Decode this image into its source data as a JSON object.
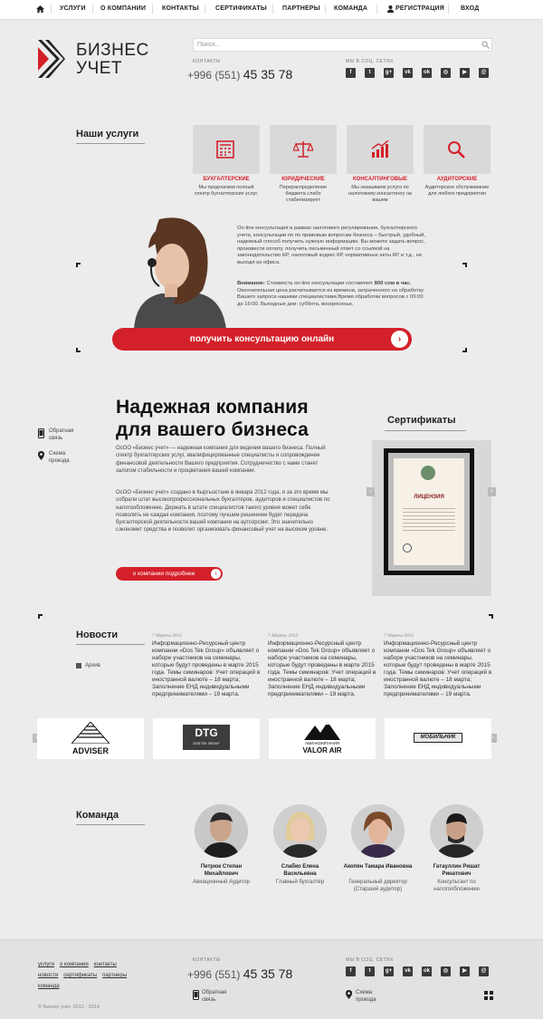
{
  "nav": {
    "items": [
      "УСЛУГИ",
      "О КОМПАНИИ",
      "КОНТАКТЫ",
      "СЕРТИФИКАТЫ",
      "ПАРТНЕРЫ",
      "КОМАНДА",
      "РЕГИСТРАЦИЯ",
      "ВХОД"
    ]
  },
  "logo": {
    "line1": "БИЗНЕС",
    "line2": "УЧЕТ"
  },
  "search": {
    "placeholder": "Поиск..."
  },
  "contacts": {
    "label": "КОНТАКТЫ",
    "phone_prefix": "+996 (551)",
    "phone_main": "45 35 78"
  },
  "social": {
    "label": "МЫ В СОЦ. СЕТЯХ",
    "icons": [
      "facebook-icon",
      "twitter-icon",
      "google-plus-icon",
      "vk-icon",
      "odnoklassniki-icon",
      "instagram-icon",
      "youtube-icon",
      "moimir-icon"
    ]
  },
  "services": {
    "title": "Наши услуги",
    "items": [
      {
        "name": "БУХГАЛТЕРСКИЕ",
        "desc": "Мы предлагаем полный спектр бухгалтерских услуг."
      },
      {
        "name": "ЮРИДИЧЕСКИЕ",
        "desc": "Перераспределение бюджета слабо стабилизирует"
      },
      {
        "name": "КОНСАЛТИНГОВЫЕ",
        "desc": "Мы оказываем услуги по налоговому консалтингу на вашем"
      },
      {
        "name": "АУДИТОРСКИЕ",
        "desc": "Аудиторское обслуживание для любого предприятия"
      }
    ]
  },
  "consult": {
    "text": "On-line консультация в рамках налогового регулирования, бухгалтерского учета, консультации по по правовым вопросам бизнеса – быстрый, удобный, надежный способ получить нужную информацию. Вы можете задать вопрос, произвести оплату, получить письменный ответ со ссылкой на законодательство КР; налоговый кодекс КР, нормативные акты КР, и т.д., не выходя из офиса.",
    "note_bold": "Внимание:",
    "note_text1": "Стоимость on-line консультации составляет",
    "note_price": "800 сом в час.",
    "note_text2": "Окончательная цена расчитывается из времени, затраченного на обработку Вашего запроса нашими специалистами.Время обработки вопросов с 09:00 до 16:00. Выходные дни: суббота, воскресенье.",
    "button": "получить консультацию онлайн"
  },
  "company": {
    "title_line1": "Надежная компания",
    "title_line2": "для вашего бизнеса",
    "para1": "ОсОО «Бизнес учет» — надежная компания для ведения вашего бизнеса. Полный спектр бухгалтерских услуг, квалифицированные специалисты и сопровождение финансовой деятельности Вашего предприятия. Сотрудничество с нами станет залогом стабильности и процветания вашей компании.",
    "para2": "ОсОО «Бизнес учет» создано в Кыргызстане в январе 2012 года, и за это время мы собрали штат высокопрофессиональных бухгалтеров, аудиторов и специалистов по налогообложению. Держать в штате специалистов такого уровня может себе позволить не каждая компания, поэтому лучшим решением будет передача бухгалтерской деятельности вашей компании на аутсорсинг. Это значительно сэкономит средства и позволит организовать финансовый учет на высоком уровне.",
    "button": "о компании подробнее",
    "feedback": "Обратная связь",
    "map": "Схема проезда"
  },
  "certs": {
    "title": "Сертификаты",
    "doc_title": "ЛИЦЕНЗИЯ"
  },
  "news": {
    "title": "Новости",
    "archive": "Архив",
    "items": [
      {
        "date": "7 Марта 2015",
        "text": "Информационно-Ресурсный центр компании «Dos Tek Group» объявляет о наборе участников на семинары, которые будут проведены в марте 2015 года. Темы семинаров: Учет операций в иностранной валюте – 18 марта; Заполнение ЕНД индивидуальными предпринимателями – 19 марта."
      },
      {
        "date": "7 Марта 2015",
        "text": "Информационно-Ресурсный центр компании «Dos Tek Group» объявляет о наборе участников на семинары, которые будут проведены в марте 2015 года. Темы семинаров: Учет операций в иностранной валюте – 18 марта; Заполнение ЕНД индивидуальными предпринимателями – 19 марта."
      },
      {
        "date": "7 Марта 2015",
        "text": "Информационно-Ресурсный центр компании «Dos Tek Group» объявляет о наборе участников на семинары, которые будут проведены в марте 2015 года. Темы семинаров: Учет операций в иностранной валюте – 18 марта; Заполнение ЕНД индивидуальными предпринимателями – 19 марта."
      }
    ]
  },
  "partners": {
    "items": [
      {
        "name": "ADVISER"
      },
      {
        "name": "DTG",
        "sub": "DOS TEK GROUP"
      },
      {
        "name": "АВИАКОМПАНИЯ",
        "sub": "VALOR AIR"
      },
      {
        "name": "МОБИЛЬНИК"
      }
    ]
  },
  "team": {
    "title": "Команда",
    "members": [
      {
        "name": "Петрюк Степан Михайлович",
        "role": "Авиационный Аудитор"
      },
      {
        "name": "Слабко Елена Васильевна",
        "role": "Главный бухгалтер"
      },
      {
        "name": "Акопян Тамара Ивановна",
        "role": "Генеральный директор (Старший аудитор)"
      },
      {
        "name": "Гатауллин Ришат Ринатович",
        "role": "Консультант по налогообложению"
      }
    ]
  },
  "footer": {
    "links_row1": [
      "услуги",
      "о компании",
      "контакты"
    ],
    "links_row2": [
      "новости",
      "сертификаты",
      "партнеры"
    ],
    "links_row3": [
      "команда"
    ],
    "contacts_label": "КОНТАКТЫ",
    "phone_prefix": "+996 (551)",
    "phone_main": "45 35 78",
    "social_label": "МЫ В СОЦ. СЕТЯХ",
    "feedback": "Обратная связь",
    "map": "Схема проезда",
    "copyright": "© Бизнес учет, 2012 - 2014"
  },
  "colors": {
    "accent": "#d4202a",
    "dark": "#222222",
    "bg": "#ececec"
  }
}
